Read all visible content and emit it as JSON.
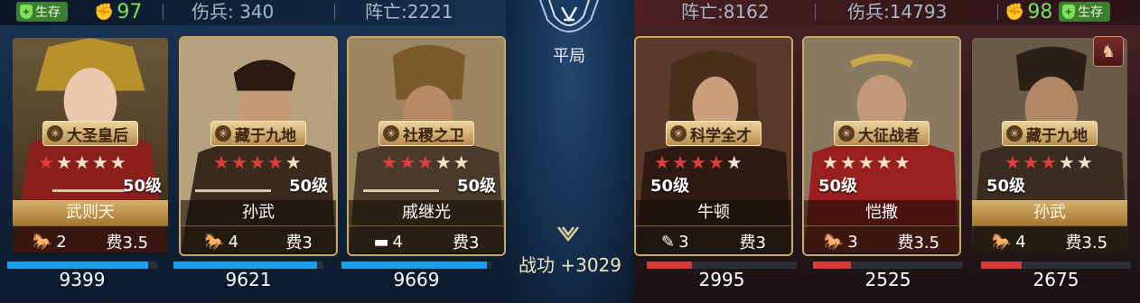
{
  "left_team": {
    "status": "生存",
    "power": "97",
    "wounded": "伤兵: 340",
    "killed": "阵亡:2221",
    "heroes": [
      {
        "title": "大圣皇后",
        "stars_on": 1,
        "stars_total": 5,
        "level": "50级",
        "name": "武则天",
        "troops": "2",
        "cost": "费3.5",
        "hp": "9399",
        "hp_pct": 0.94,
        "gold": true,
        "troop_icon": "cavalry-icon"
      },
      {
        "title": "藏于九地",
        "stars_on": 4,
        "stars_total": 5,
        "level": "50级",
        "name": "孙武",
        "troops": "4",
        "cost": "费3",
        "hp": "9621",
        "hp_pct": 0.96,
        "gold": false,
        "troop_icon": "cavalry-icon"
      },
      {
        "title": "社稷之卫",
        "stars_on": 3,
        "stars_total": 5,
        "level": "50级",
        "name": "戚继光",
        "troops": "4",
        "cost": "费3",
        "hp": "9669",
        "hp_pct": 0.97,
        "gold": false,
        "troop_icon": "tank-icon"
      }
    ]
  },
  "right_team": {
    "status": "生存",
    "power": "98",
    "wounded": "伤兵:14793",
    "killed": "阵亡:8162",
    "heroes": [
      {
        "title": "科学全才",
        "stars_on": 4,
        "stars_total": 5,
        "level": "50级",
        "name": "牛顿",
        "troops": "3",
        "cost": "费3",
        "hp": "2995",
        "hp_pct": 0.3,
        "gold": false,
        "troop_icon": "artillery-icon"
      },
      {
        "title": "大征战者",
        "stars_on": 0,
        "stars_total": 5,
        "level": "50级",
        "name": "恺撒",
        "troops": "3",
        "cost": "费3.5",
        "hp": "2525",
        "hp_pct": 0.25,
        "gold": false,
        "troop_icon": "cavalry-icon"
      },
      {
        "title": "藏于九地",
        "stars_on": 3,
        "stars_total": 5,
        "level": "50级",
        "name": "孙武",
        "troops": "4",
        "cost": "费3.5",
        "hp": "2675",
        "hp_pct": 0.27,
        "gold": true,
        "troop_icon": "cavalry-icon"
      }
    ]
  },
  "center": {
    "result": "平局",
    "merit": "战功 +3029"
  },
  "colors": {
    "left_hp": "#1aa0e8",
    "right_hp": "#d63a3a",
    "alive_green": "#3d7d2e",
    "gold": "#c9a76a"
  }
}
